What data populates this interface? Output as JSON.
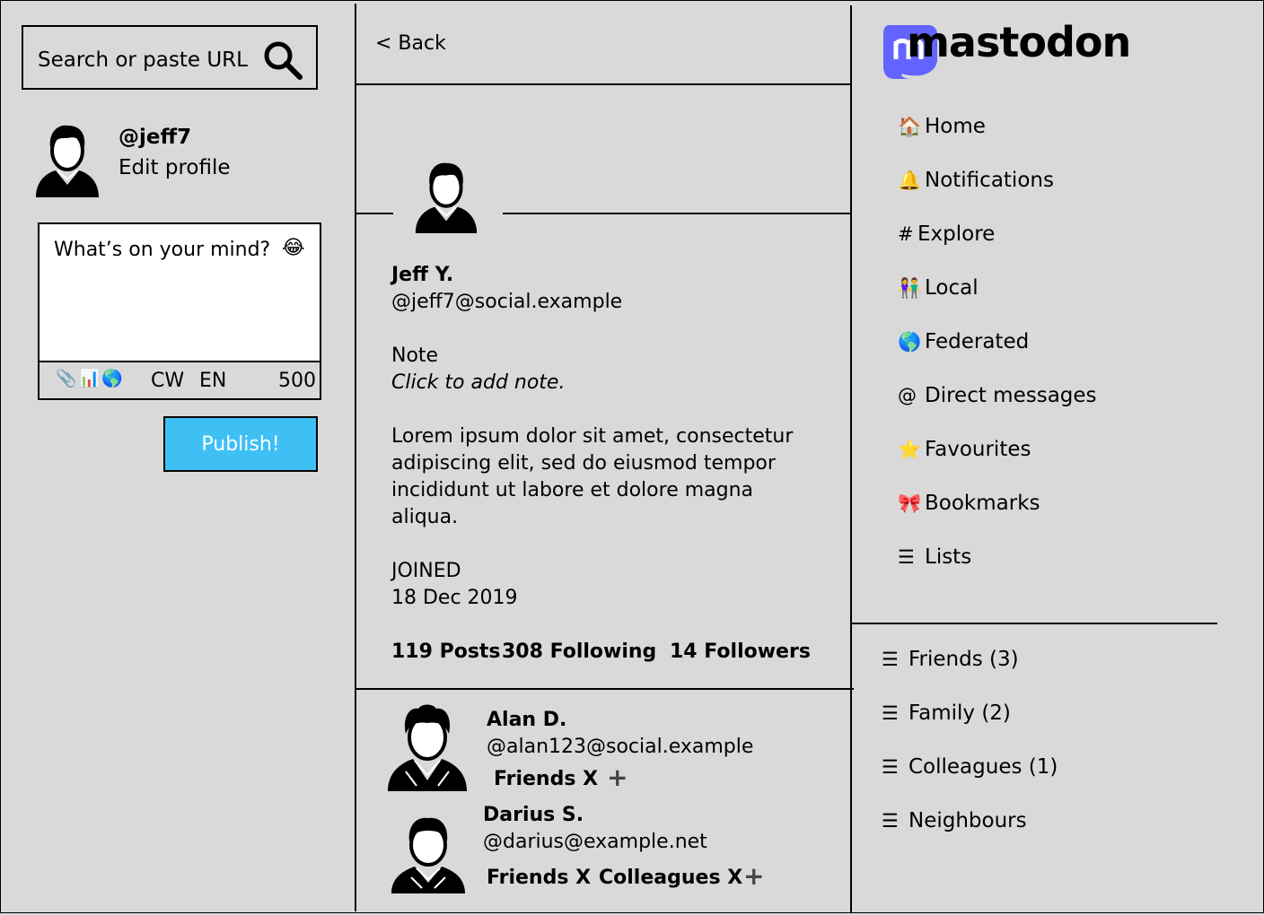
{
  "search": {
    "placeholder": "Search or paste URL"
  },
  "profile": {
    "handle": "@jeff7",
    "edit_label": "Edit profile"
  },
  "composer": {
    "placeholder": "What’s on your mind?",
    "emoji": "😂",
    "tools": "📎📊🌎",
    "cw": "CW",
    "lang": "EN",
    "char_count": "500",
    "publish_label": "Publish!",
    "publish_color": "#3ec0f5"
  },
  "center": {
    "back_label": "< Back",
    "display_name": "Jeff Y.",
    "account": "@jeff7@social.example",
    "note_label": "Note",
    "note_placeholder": "Click to add note.",
    "bio_lines": [
      "Lorem ipsum dolor sit amet, consectetur",
      "adipiscing elit, sed do eiusmod tempor",
      "incididunt ut labore et dolore magna",
      "aliqua."
    ],
    "joined_label": "JOINED",
    "joined_date": "18 Dec 2019",
    "stats": {
      "posts": "119 Posts",
      "following": "308 Following",
      "followers": "14 Followers"
    },
    "follows": [
      {
        "name": "Alan D.",
        "handle": "@alan123@social.example",
        "lists": [
          "Friends X"
        ],
        "add": "+"
      },
      {
        "name": "Darius S.",
        "handle": "@darius@example.net",
        "lists": [
          "Friends X",
          "Colleagues X"
        ],
        "add": "+"
      }
    ]
  },
  "brand": {
    "name": "mastodon",
    "color": "#6364ff"
  },
  "nav": [
    {
      "icon": "🏠",
      "label": "Home"
    },
    {
      "icon": "🔔",
      "label": "Notifications"
    },
    {
      "icon": "#",
      "label": "Explore"
    },
    {
      "icon": "👫",
      "label": "Local"
    },
    {
      "icon": "🌎",
      "label": "Federated"
    },
    {
      "icon": "@",
      "label": "Direct messages"
    },
    {
      "icon": "⭐",
      "label": "Favourites"
    },
    {
      "icon": "🎀",
      "label": "Bookmarks"
    },
    {
      "icon": "☰",
      "label": "Lists"
    }
  ],
  "lists": [
    {
      "icon": "☰",
      "label": "Friends (3)"
    },
    {
      "icon": "☰",
      "label": "Family (2)"
    },
    {
      "icon": "☰",
      "label": "Colleagues (1)"
    },
    {
      "icon": "☰",
      "label": "Neighbours"
    }
  ]
}
